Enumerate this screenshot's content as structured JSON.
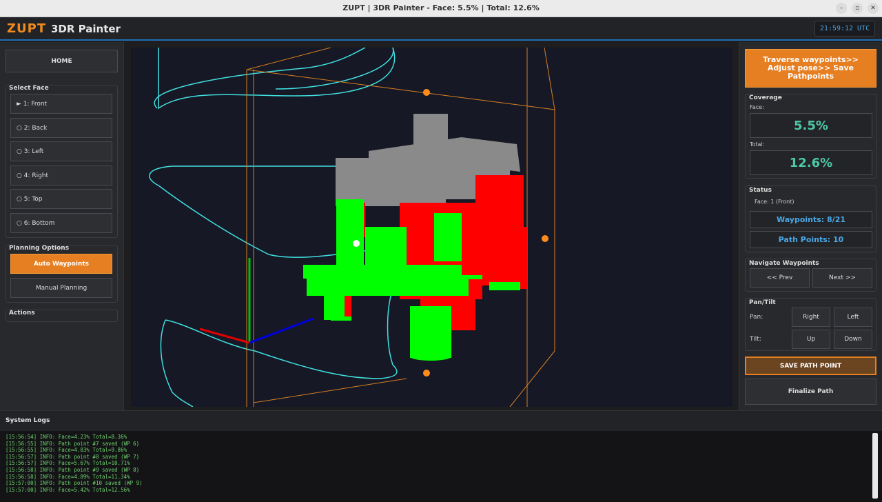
{
  "window": {
    "title": "ZUPT | 3DR Painter - Face: 5.5% | Total: 12.6%",
    "controls": [
      "–",
      "▫",
      "✕"
    ]
  },
  "header": {
    "brand": "ZUPT",
    "app_name": "3DR Painter",
    "clock": "21:59:12 UTC"
  },
  "left": {
    "home_label": "HOME",
    "select_face_title": "Select Face",
    "faces": [
      "► 1: Front",
      "○ 2: Back",
      "○ 3: Left",
      "○ 4: Right",
      "○ 5: Top",
      "○ 6: Bottom"
    ],
    "planning_title": "Planning Options",
    "auto_waypoints": "Auto Waypoints",
    "manual_planning": "Manual Planning",
    "actions_title": "Actions"
  },
  "right": {
    "instruction": "Traverse waypoints>> Adjust pose>> Save Pathpoints",
    "coverage_title": "Coverage",
    "face_label": "Face:",
    "face_value": "5.5%",
    "total_label": "Total:",
    "total_value": "12.6%",
    "status_title": "Status",
    "status_face": "Face: 1 (Front)",
    "waypoints": "Waypoints: 8/21",
    "path_points": "Path Points: 10",
    "navigate_title": "Navigate Waypoints",
    "prev": "<< Prev",
    "next": "Next >>",
    "pantilt_title": "Pan/Tilt",
    "pan_label": "Pan:",
    "pan_right": "Right",
    "pan_left": "Left",
    "tilt_label": "Tilt:",
    "tilt_up": "Up",
    "tilt_down": "Down",
    "save_path_point": "SAVE PATH POINT",
    "finalize_path": "Finalize Path"
  },
  "logs": {
    "title": "System Logs",
    "lines": [
      "[15:56:54] INFO: Face=4.23% Total=8.36%",
      "[15:56:55] INFO: Path point #7 saved (WP 6)",
      "[15:56:55] INFO: Face=4.83% Total=9.86%",
      "[15:56:57] INFO: Path point #8 saved (WP 7)",
      "[15:56:57] INFO: Face=5.67% Total=10.71%",
      "[15:56:58] INFO: Path point #9 saved (WP 8)",
      "[15:56:58] INFO: Face=4.89% Total=11.34%",
      "[15:57:00] INFO: Path point #10 saved (WP 9)",
      "[15:57:00] INFO: Face=5.42% Total=12.56%"
    ]
  },
  "colors": {
    "accent": "#e67e22",
    "coverage_value": "#4ec9a8",
    "status_value": "#4aa7e6",
    "log_text": "#6fd36f",
    "painted": "#ff0000",
    "target_face": "#00ff00",
    "unpainted": "#8a8a8a",
    "path": "#40e0e0",
    "bounding_box": "#d88020"
  }
}
